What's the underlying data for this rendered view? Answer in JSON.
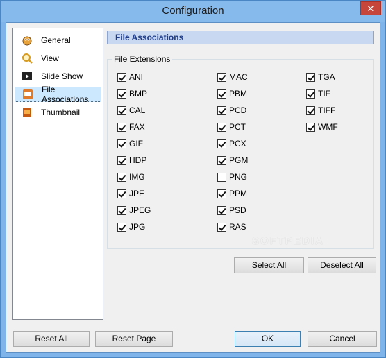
{
  "window": {
    "title": "Configuration",
    "close_glyph": "✕"
  },
  "nav": {
    "items": [
      {
        "label": "General",
        "icon": "general-icon"
      },
      {
        "label": "View",
        "icon": "magnifier-icon"
      },
      {
        "label": "Slide Show",
        "icon": "slideshow-icon"
      },
      {
        "label": "File Associations",
        "icon": "file-associations-icon",
        "selected": true
      },
      {
        "label": "Thumbnail",
        "icon": "thumbnail-icon"
      }
    ]
  },
  "panel": {
    "header": "File Associations",
    "group_label": "File Extensions",
    "extensions": [
      {
        "label": "ANI",
        "checked": true
      },
      {
        "label": "BMP",
        "checked": true
      },
      {
        "label": "CAL",
        "checked": true
      },
      {
        "label": "FAX",
        "checked": true
      },
      {
        "label": "GIF",
        "checked": true
      },
      {
        "label": "HDP",
        "checked": true
      },
      {
        "label": "IMG",
        "checked": true
      },
      {
        "label": "JPE",
        "checked": true
      },
      {
        "label": "JPEG",
        "checked": true
      },
      {
        "label": "JPG",
        "checked": true
      },
      {
        "label": "MAC",
        "checked": true
      },
      {
        "label": "PBM",
        "checked": true
      },
      {
        "label": "PCD",
        "checked": true
      },
      {
        "label": "PCT",
        "checked": true
      },
      {
        "label": "PCX",
        "checked": true
      },
      {
        "label": "PGM",
        "checked": true
      },
      {
        "label": "PNG",
        "checked": false
      },
      {
        "label": "PPM",
        "checked": true
      },
      {
        "label": "PSD",
        "checked": true
      },
      {
        "label": "RAS",
        "checked": true
      },
      {
        "label": "TGA",
        "checked": true
      },
      {
        "label": "TIF",
        "checked": true
      },
      {
        "label": "TIFF",
        "checked": true
      },
      {
        "label": "WMF",
        "checked": true
      }
    ],
    "select_all": "Select All",
    "deselect_all": "Deselect All"
  },
  "footer": {
    "reset_all": "Reset All",
    "reset_page": "Reset Page",
    "ok": "OK",
    "cancel": "Cancel"
  },
  "watermark": "SOFTPEDIA",
  "colors": {
    "accent": "#1d3b88",
    "header_bg": "#c9d8f1",
    "title_bar": "#86b9ec",
    "close": "#c7463b"
  }
}
